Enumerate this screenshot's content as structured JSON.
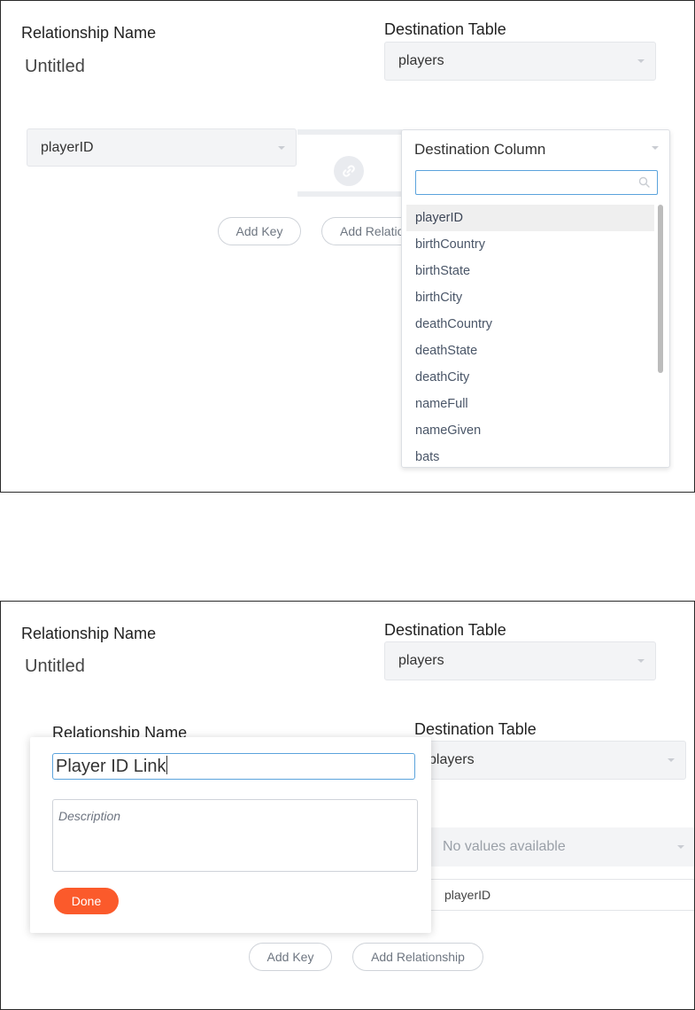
{
  "top": {
    "relationship_name_label": "Relationship Name",
    "relationship_name_value": "Untitled",
    "destination_table_label": "Destination Table",
    "destination_table_value": "players",
    "source_column_value": "playerID",
    "add_key_label": "Add Key",
    "add_relationship_label": "Add Relatio",
    "dropdown": {
      "title": "Destination Column",
      "search_placeholder": "",
      "selected": "playerID",
      "options": [
        "playerID",
        "birthCountry",
        "birthState",
        "birthCity",
        "deathCountry",
        "deathState",
        "deathCity",
        "nameFull",
        "nameGiven",
        "bats"
      ]
    }
  },
  "bottom": {
    "relationship_name_label": "Relationship Name",
    "relationship_name_value": "Untitled",
    "destination_table_label": "Destination Table",
    "destination_table_value": "players",
    "inner_relationship_name_label": "Relationship Name",
    "inner_destination_table_label": "Destination Table",
    "inner_destination_table_value": "players",
    "no_values_text": "No values available",
    "inner_column_value": "playerID",
    "add_key_label": "Add Key",
    "add_relationship_label": "Add Relationship",
    "modal": {
      "name_value": "Player ID Link",
      "description_placeholder": "Description",
      "done_label": "Done"
    }
  },
  "colors": {
    "accent_blue": "#5ba3dc",
    "done_orange": "#fb5a2b",
    "select_bg": "#f3f4f6"
  },
  "icons": [
    "link-icon",
    "search-icon",
    "caret-down-icon"
  ]
}
